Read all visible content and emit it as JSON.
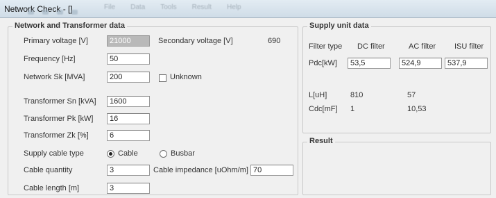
{
  "window": {
    "title": "Network Check - []"
  },
  "menu": [
    "File",
    "Data",
    "Tools",
    "Result",
    "Help"
  ],
  "network_group": {
    "title": "Network and Transformer data",
    "primary_voltage": {
      "label": "Primary voltage [V]",
      "value": "21000"
    },
    "secondary_voltage": {
      "label": "Secondary voltage [V]",
      "value": "690"
    },
    "frequency": {
      "label": "Frequency [Hz]",
      "value": "50"
    },
    "network_sk": {
      "label": "Network Sk [MVA]",
      "value": "200"
    },
    "unknown": {
      "label": "Unknown",
      "checked": false
    },
    "transformer_sn": {
      "label": "Transformer Sn [kVA]",
      "value": "1600"
    },
    "transformer_pk": {
      "label": "Transformer Pk [kW]",
      "value": "16"
    },
    "transformer_zk": {
      "label": "Transformer Zk [%]",
      "value": "6"
    },
    "supply_cable_type": {
      "label": "Supply cable type",
      "cable": "Cable",
      "busbar": "Busbar",
      "selected": "Cable"
    },
    "cable_quantity": {
      "label": "Cable quantity",
      "value": "3"
    },
    "cable_impedance": {
      "label": "Cable impedance [uOhm/m]",
      "value": "70"
    },
    "cable_length": {
      "label": "Cable length [m]",
      "value": "3"
    }
  },
  "supply_group": {
    "title": "Supply unit data",
    "filter_type_label": "Filter type",
    "columns": [
      "DC filter",
      "AC filter",
      "ISU filter"
    ],
    "pdc": {
      "label": "Pdc[kW]",
      "values": [
        "53,5",
        "524,9",
        "537,9"
      ]
    },
    "l": {
      "label": "L[uH]",
      "values": [
        "810",
        "57"
      ]
    },
    "cdc": {
      "label": "Cdc[mF]",
      "values": [
        "1",
        "10,53"
      ]
    }
  },
  "result_group": {
    "title": "Result"
  }
}
